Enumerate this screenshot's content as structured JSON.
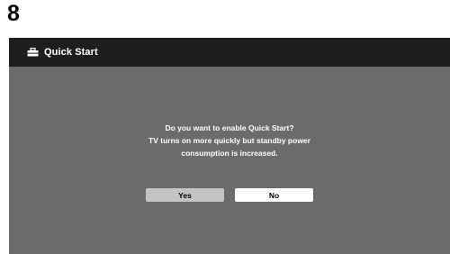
{
  "page": {
    "step_number": "8"
  },
  "title_bar": {
    "icon": "toolbox-icon",
    "title": "Quick Start"
  },
  "dialog": {
    "lines": [
      "Do you want to enable Quick Start?",
      "TV turns on more quickly but standby power",
      "consumption is increased."
    ]
  },
  "buttons": {
    "yes_label": "Yes",
    "no_label": "No",
    "selected": "No"
  },
  "colors": {
    "screen_background": "#6b6b6b",
    "title_bar_background": "#1e1e1e",
    "yes_button": "#c4c4c4",
    "no_button": "#ffffff"
  }
}
